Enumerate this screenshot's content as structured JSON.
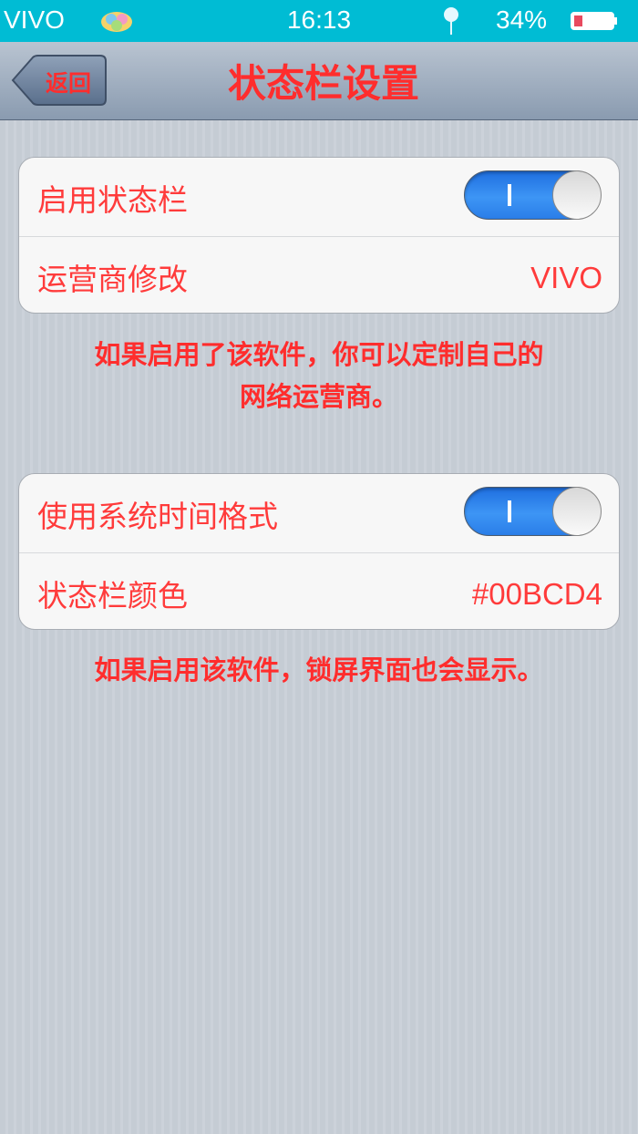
{
  "status_bar": {
    "carrier": "VIVO",
    "time": "16:13",
    "battery_percent": "34%",
    "battery_level": 0.34,
    "icons": [
      "app-notification-icon",
      "location-pin-icon",
      "battery-icon"
    ]
  },
  "nav": {
    "back_label": "返回",
    "title": "状态栏设置"
  },
  "group1": {
    "enable_label": "启用状态栏",
    "enable_on": true,
    "carrier_label": "运营商修改",
    "carrier_value": "VIVO"
  },
  "hint1": {
    "line1": "如果启用了该软件，你可以定制自己的",
    "line2": "网络运营商。"
  },
  "group2": {
    "time_format_label": "使用系统时间格式",
    "time_format_on": true,
    "color_label": "状态栏颜色",
    "color_value": "#00BCD4"
  },
  "hint2": {
    "line1": "如果启用该软件，锁屏界面也会显示。"
  },
  "colors": {
    "status_bar": "#00bcd4",
    "accent_text": "#ff2d2d",
    "toggle_on": "#2a7ee8"
  }
}
